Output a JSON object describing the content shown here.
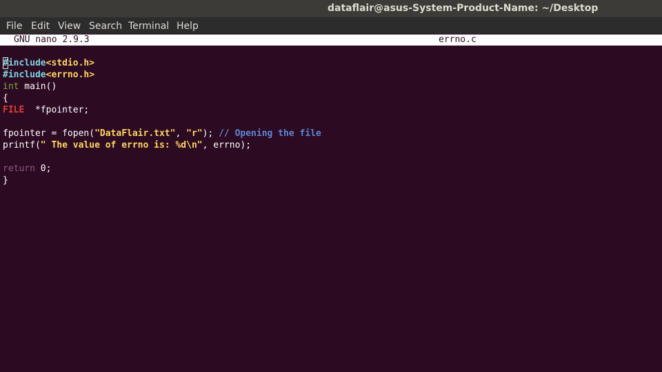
{
  "window": {
    "title": "dataflair@asus-System-Product-Name: ~/Desktop"
  },
  "menubar": {
    "items": [
      "File",
      "Edit",
      "View",
      "Search",
      "Terminal",
      "Help"
    ]
  },
  "nano": {
    "version": "GNU nano 2.9.3",
    "filename": "errno.c"
  },
  "code": {
    "line1": {
      "pre": "#include",
      "hdr": "<stdio.h>"
    },
    "line2": {
      "pre": "#include",
      "hdr": "<errno.h>"
    },
    "line3": {
      "type": "int",
      "rest": " main()"
    },
    "line4": {
      "text": "{"
    },
    "line5": {
      "type": "FILE",
      "rest": "  *fpointer;"
    },
    "line6": {
      "text": ""
    },
    "line7": {
      "a": "fpointer = fopen(",
      "s1": "\"DataFlair.txt\"",
      "b": ", ",
      "s2": "\"r\"",
      "c": "); ",
      "comment": "// Opening the file"
    },
    "line8": {
      "a": "printf(",
      "s1": "\" The value of errno is: %d\\n\"",
      "b": ", errno);"
    },
    "line9": {
      "text": ""
    },
    "line10": {
      "kw": "return",
      "rest": " 0;"
    },
    "line11": {
      "text": "}"
    }
  },
  "colors": {
    "terminal_bg": "#2c0a22",
    "title_bg": "#3c3b37",
    "menubar_bg": "#2c2c2c",
    "preprocessor": "#7fd4e6",
    "string": "#ffd75f",
    "comment": "#5f87d7",
    "type": "#7cab3e",
    "file_type": "#e33b3b"
  }
}
